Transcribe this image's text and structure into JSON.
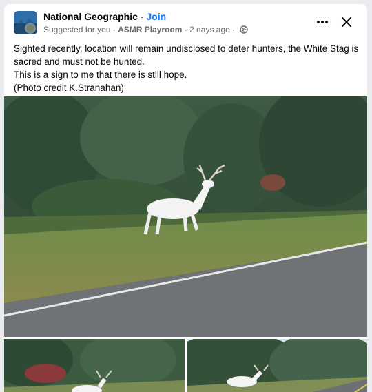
{
  "post": {
    "page_name": "National Geographic",
    "separator": " · ",
    "join_label": "Join",
    "suggested_label": "Suggested for you · ",
    "group_name": "ASMR Playroom",
    "time_text": " · 2 days ago ·",
    "text_lines": [
      "Sighted recently, location will remain undisclosed to deter hunters, the White Stag is sacred and must not be hunted.",
      "This is a sign to me that there is still hope.",
      "(Photo credit K.Stranahan)"
    ]
  },
  "icons": {
    "more": "more-options-icon",
    "close": "close-icon",
    "audience": "globe-icon"
  },
  "colors": {
    "link": "#1877f2",
    "meta": "#65676b",
    "text": "#050505"
  }
}
